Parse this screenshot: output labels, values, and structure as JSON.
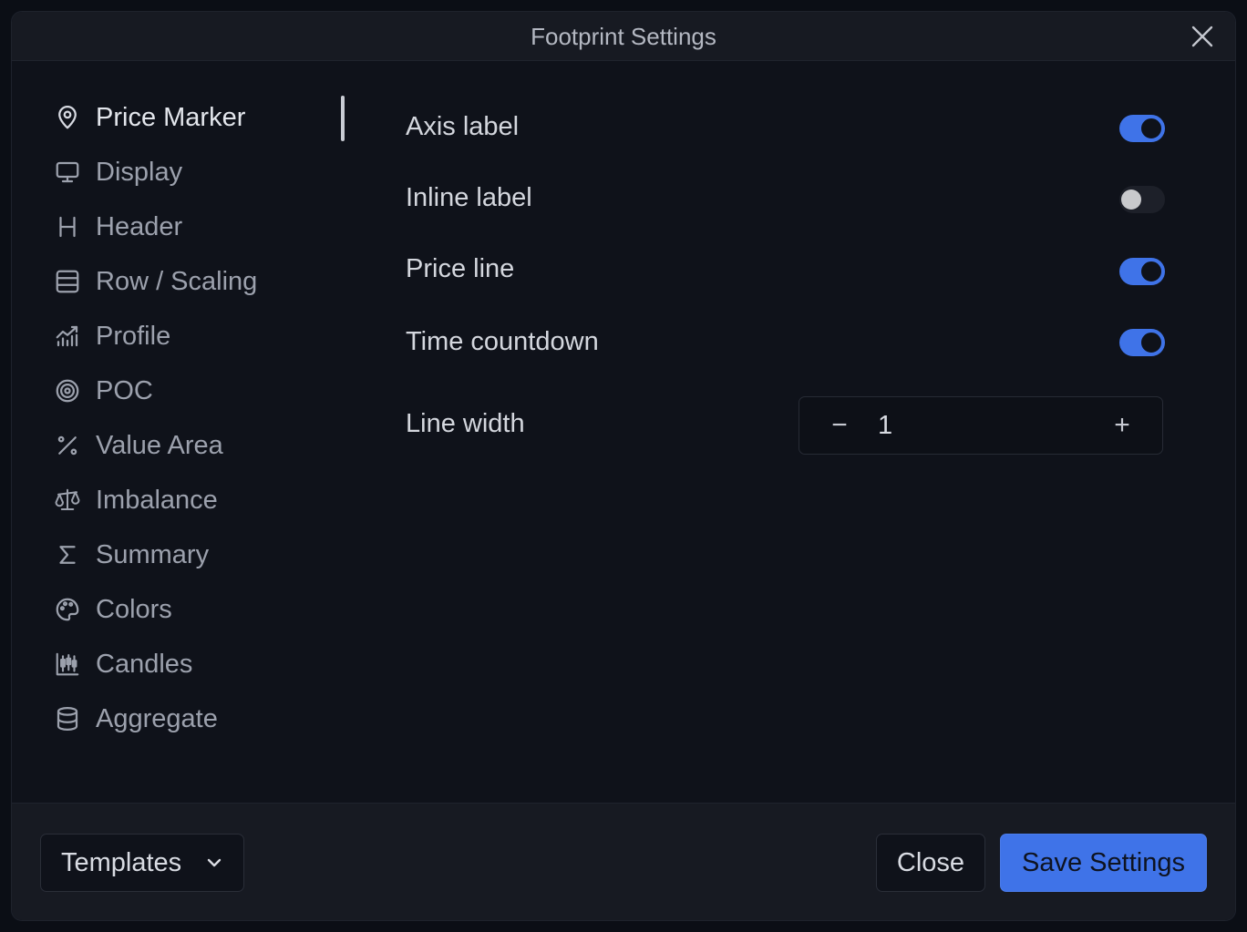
{
  "dialog": {
    "title": "Footprint Settings"
  },
  "sidebar": {
    "items": [
      {
        "label": "Price Marker",
        "icon": "map-pin-icon",
        "active": true
      },
      {
        "label": "Display",
        "icon": "monitor-icon"
      },
      {
        "label": "Header",
        "icon": "heading-icon"
      },
      {
        "label": "Row / Scaling",
        "icon": "rows-icon"
      },
      {
        "label": "Profile",
        "icon": "chart-bars-icon"
      },
      {
        "label": "POC",
        "icon": "target-icon"
      },
      {
        "label": "Value Area",
        "icon": "percent-icon"
      },
      {
        "label": "Imbalance",
        "icon": "scale-icon"
      },
      {
        "label": "Summary",
        "icon": "sigma-icon"
      },
      {
        "label": "Colors",
        "icon": "palette-icon"
      },
      {
        "label": "Candles",
        "icon": "candlestick-icon"
      },
      {
        "label": "Aggregate",
        "icon": "database-icon"
      }
    ]
  },
  "settings": {
    "axis_label": {
      "label": "Axis label",
      "enabled": true
    },
    "inline_label": {
      "label": "Inline label",
      "enabled": false
    },
    "price_line": {
      "label": "Price line",
      "enabled": true
    },
    "time_countdown": {
      "label": "Time countdown",
      "enabled": true
    },
    "line_width": {
      "label": "Line width",
      "value": "1",
      "minus": "−",
      "plus": "+"
    }
  },
  "footer": {
    "templates_label": "Templates",
    "close_label": "Close",
    "save_label": "Save Settings"
  },
  "colors": {
    "accent": "#3f73e8",
    "background": "#0f121a",
    "header": "#171a22"
  }
}
